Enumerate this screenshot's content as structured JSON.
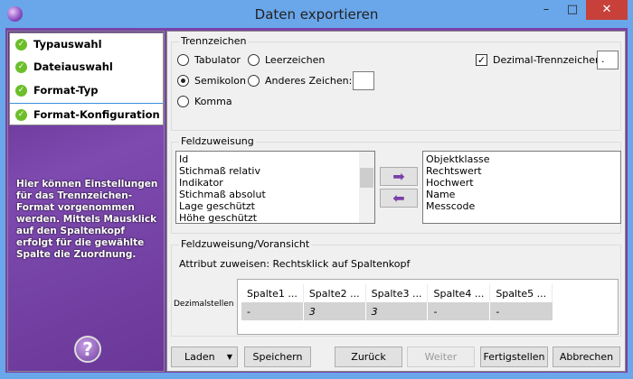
{
  "window": {
    "title": "Daten exportieren",
    "minimize": "–",
    "maximize": "□",
    "close": "✕"
  },
  "steps": [
    {
      "label": "Typauswahl"
    },
    {
      "label": "Dateiauswahl"
    },
    {
      "label": "Format-Typ"
    },
    {
      "label": "Format-Konfiguration"
    }
  ],
  "help_text": "Hier können Einstellungen für das Trennzeichen-Format vorgenommen werden. Mittels Mausklick auf den Spaltenkopf erfolgt für die gewählte Spalte die Zuordnung.",
  "help_button": "?",
  "separator": {
    "legend": "Trennzeichen",
    "options": [
      "Tabulator",
      "Leerzeichen",
      "Semikolon",
      "Anderes Zeichen:",
      "Komma"
    ],
    "selected": "Semikolon",
    "other_value": "",
    "decimal_label": "Dezimal-Trennzeichen",
    "decimal_checked": true,
    "decimal_value": "."
  },
  "fields": {
    "legend": "Feldzuweisung",
    "available": [
      "Id",
      "Stichmaß relativ",
      "Indikator",
      "Stichmaß absolut",
      "Lage geschützt",
      "Höhe geschützt"
    ],
    "assigned": [
      "Objektklasse",
      "Rechtswert",
      "Hochwert",
      "Name",
      "Messcode"
    ],
    "add": "➡",
    "remove": "⬅"
  },
  "preview": {
    "legend": "Feldzuweisung/Voransicht",
    "hint": "Attribut zuweisen: Rechtsklick auf Spaltenkopf",
    "row_label": "Dezimalstellen",
    "columns": [
      "Spalte1 ...",
      "Spalte2 ...",
      "Spalte3 ...",
      "Spalte4 ...",
      "Spalte5 ..."
    ],
    "values": [
      "-",
      "3",
      "3",
      "-",
      "-"
    ]
  },
  "buttons": {
    "load": "Laden",
    "save": "Speichern",
    "back": "Zurück",
    "next": "Weiter",
    "finish": "Fertigstellen",
    "cancel": "Abbrechen"
  }
}
